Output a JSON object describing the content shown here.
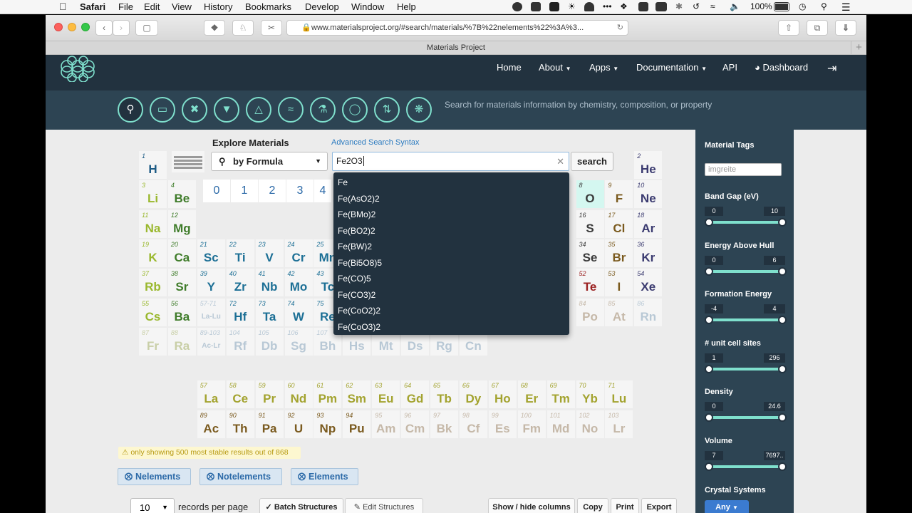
{
  "menubar": {
    "app": "Safari",
    "items": [
      "File",
      "Edit",
      "View",
      "History",
      "Bookmarks",
      "Develop",
      "Window",
      "Help"
    ],
    "battery": "100%",
    "battery_pct": 100
  },
  "browser": {
    "url": "www.materialsproject.org/#search/materials/%7B%22nelements%22%3A%3...",
    "tab_title": "Materials Project",
    "new_tab_symbol": "+"
  },
  "nav": {
    "home": "Home",
    "about": "About",
    "apps": "Apps",
    "documentation": "Documentation",
    "api": "API",
    "dashboard": "Dashboard"
  },
  "tagline": "Search for materials information by chemistry, composition, or property",
  "tools": [
    "search-icon",
    "battery-icon",
    "tools-icon",
    "shield-icon",
    "triangle-icon",
    "feather-icon",
    "flask-icon",
    "thermometer-icon",
    "exchange-icon",
    "aperture-icon"
  ],
  "search": {
    "heading": "Explore Materials",
    "advanced_link": "Advanced Search Syntax",
    "mode": "by Formula",
    "query": "Fe2O3",
    "button": "search",
    "suggestions": [
      "Fe",
      "Fe(AsO2)2",
      "Fe(BMo)2",
      "Fe(BO2)2",
      "Fe(BW)2",
      "Fe(Bi5O8)5",
      "Fe(CO)5",
      "Fe(CO3)2",
      "Fe(CoO2)2",
      "Fe(CoO3)2"
    ],
    "number_buttons": [
      "0",
      "1",
      "2",
      "3",
      "4"
    ]
  },
  "periodic_table": [
    {
      "n": "1",
      "s": "H",
      "row": 0,
      "col": 0,
      "cls": "c-h"
    },
    {
      "n": "2",
      "s": "He",
      "row": 0,
      "col": 17,
      "cls": "c-m"
    },
    {
      "n": "3",
      "s": "Li",
      "row": 1,
      "col": 0,
      "cls": "c-l"
    },
    {
      "n": "4",
      "s": "Be",
      "row": 1,
      "col": 1,
      "cls": "c-b"
    },
    {
      "n": "8",
      "s": "O",
      "row": 1,
      "col": 15,
      "cls": "c-n",
      "sel": true
    },
    {
      "n": "9",
      "s": "F",
      "row": 1,
      "col": 16,
      "cls": "c-act"
    },
    {
      "n": "10",
      "s": "Ne",
      "row": 1,
      "col": 17,
      "cls": "c-m"
    },
    {
      "n": "11",
      "s": "Na",
      "row": 2,
      "col": 0,
      "cls": "c-l"
    },
    {
      "n": "12",
      "s": "Mg",
      "row": 2,
      "col": 1,
      "cls": "c-b"
    },
    {
      "n": "16",
      "s": "S",
      "row": 2,
      "col": 15,
      "cls": "c-n"
    },
    {
      "n": "17",
      "s": "Cl",
      "row": 2,
      "col": 16,
      "cls": "c-act"
    },
    {
      "n": "18",
      "s": "Ar",
      "row": 2,
      "col": 17,
      "cls": "c-m"
    },
    {
      "n": "19",
      "s": "K",
      "row": 3,
      "col": 0,
      "cls": "c-l"
    },
    {
      "n": "20",
      "s": "Ca",
      "row": 3,
      "col": 1,
      "cls": "c-b"
    },
    {
      "n": "21",
      "s": "Sc",
      "row": 3,
      "col": 2,
      "cls": "c-g"
    },
    {
      "n": "22",
      "s": "Ti",
      "row": 3,
      "col": 3,
      "cls": "c-g"
    },
    {
      "n": "23",
      "s": "V",
      "row": 3,
      "col": 4,
      "cls": "c-g"
    },
    {
      "n": "24",
      "s": "Cr",
      "row": 3,
      "col": 5,
      "cls": "c-g"
    },
    {
      "n": "25",
      "s": "Mn",
      "row": 3,
      "col": 6,
      "cls": "c-g"
    },
    {
      "n": "34",
      "s": "Se",
      "row": 3,
      "col": 15,
      "cls": "c-n"
    },
    {
      "n": "35",
      "s": "Br",
      "row": 3,
      "col": 16,
      "cls": "c-act"
    },
    {
      "n": "36",
      "s": "Kr",
      "row": 3,
      "col": 17,
      "cls": "c-m"
    },
    {
      "n": "37",
      "s": "Rb",
      "row": 4,
      "col": 0,
      "cls": "c-l"
    },
    {
      "n": "38",
      "s": "Sr",
      "row": 4,
      "col": 1,
      "cls": "c-b"
    },
    {
      "n": "39",
      "s": "Y",
      "row": 4,
      "col": 2,
      "cls": "c-g"
    },
    {
      "n": "40",
      "s": "Zr",
      "row": 4,
      "col": 3,
      "cls": "c-g"
    },
    {
      "n": "41",
      "s": "Nb",
      "row": 4,
      "col": 4,
      "cls": "c-g"
    },
    {
      "n": "42",
      "s": "Mo",
      "row": 4,
      "col": 5,
      "cls": "c-g"
    },
    {
      "n": "43",
      "s": "Tc",
      "row": 4,
      "col": 6,
      "cls": "c-g"
    },
    {
      "n": "52",
      "s": "Te",
      "row": 4,
      "col": 15,
      "cls": "c-r"
    },
    {
      "n": "53",
      "s": "I",
      "row": 4,
      "col": 16,
      "cls": "c-act"
    },
    {
      "n": "54",
      "s": "Xe",
      "row": 4,
      "col": 17,
      "cls": "c-m"
    },
    {
      "n": "55",
      "s": "Cs",
      "row": 5,
      "col": 0,
      "cls": "c-l"
    },
    {
      "n": "56",
      "s": "Ba",
      "row": 5,
      "col": 1,
      "cls": "c-b"
    },
    {
      "n": "57-71",
      "s": "La-Lu",
      "row": 5,
      "col": 2,
      "cls": "c-dim",
      "small": true
    },
    {
      "n": "72",
      "s": "Hf",
      "row": 5,
      "col": 3,
      "cls": "c-g"
    },
    {
      "n": "73",
      "s": "Ta",
      "row": 5,
      "col": 4,
      "cls": "c-g"
    },
    {
      "n": "74",
      "s": "W",
      "row": 5,
      "col": 5,
      "cls": "c-g"
    },
    {
      "n": "75",
      "s": "Re",
      "row": 5,
      "col": 6,
      "cls": "c-g"
    },
    {
      "n": "84",
      "s": "Po",
      "row": 5,
      "col": 15,
      "cls": "c-dim3"
    },
    {
      "n": "85",
      "s": "At",
      "row": 5,
      "col": 16,
      "cls": "c-dim3"
    },
    {
      "n": "86",
      "s": "Rn",
      "row": 5,
      "col": 17,
      "cls": "c-dim"
    },
    {
      "n": "87",
      "s": "Fr",
      "row": 6,
      "col": 0,
      "cls": "c-dim2"
    },
    {
      "n": "88",
      "s": "Ra",
      "row": 6,
      "col": 1,
      "cls": "c-dim2"
    },
    {
      "n": "89-103",
      "s": "Ac-Lr",
      "row": 6,
      "col": 2,
      "cls": "c-dim",
      "small": true
    },
    {
      "n": "104",
      "s": "Rf",
      "row": 6,
      "col": 3,
      "cls": "c-dim"
    },
    {
      "n": "105",
      "s": "Db",
      "row": 6,
      "col": 4,
      "cls": "c-dim"
    },
    {
      "n": "106",
      "s": "Sg",
      "row": 6,
      "col": 5,
      "cls": "c-dim"
    },
    {
      "n": "107",
      "s": "Bh",
      "row": 6,
      "col": 6,
      "cls": "c-dim"
    },
    {
      "n": "108",
      "s": "Hs",
      "row": 6,
      "col": 7,
      "cls": "c-dim"
    },
    {
      "n": "109",
      "s": "Mt",
      "row": 6,
      "col": 8,
      "cls": "c-dim"
    },
    {
      "n": "110",
      "s": "Ds",
      "row": 6,
      "col": 9,
      "cls": "c-dim"
    },
    {
      "n": "111",
      "s": "Rg",
      "row": 6,
      "col": 10,
      "cls": "c-dim"
    },
    {
      "n": "112",
      "s": "Cn",
      "row": 6,
      "col": 11,
      "cls": "c-dim"
    },
    {
      "n": "57",
      "s": "La",
      "row": 8,
      "col": 2,
      "cls": "c-lan"
    },
    {
      "n": "58",
      "s": "Ce",
      "row": 8,
      "col": 3,
      "cls": "c-lan"
    },
    {
      "n": "59",
      "s": "Pr",
      "row": 8,
      "col": 4,
      "cls": "c-lan"
    },
    {
      "n": "60",
      "s": "Nd",
      "row": 8,
      "col": 5,
      "cls": "c-lan"
    },
    {
      "n": "61",
      "s": "Pm",
      "row": 8,
      "col": 6,
      "cls": "c-lan"
    },
    {
      "n": "62",
      "s": "Sm",
      "row": 8,
      "col": 7,
      "cls": "c-lan"
    },
    {
      "n": "63",
      "s": "Eu",
      "row": 8,
      "col": 8,
      "cls": "c-lan"
    },
    {
      "n": "64",
      "s": "Gd",
      "row": 8,
      "col": 9,
      "cls": "c-lan"
    },
    {
      "n": "65",
      "s": "Tb",
      "row": 8,
      "col": 10,
      "cls": "c-lan"
    },
    {
      "n": "66",
      "s": "Dy",
      "row": 8,
      "col": 11,
      "cls": "c-lan"
    },
    {
      "n": "67",
      "s": "Ho",
      "row": 8,
      "col": 12,
      "cls": "c-lan"
    },
    {
      "n": "68",
      "s": "Er",
      "row": 8,
      "col": 13,
      "cls": "c-lan"
    },
    {
      "n": "69",
      "s": "Tm",
      "row": 8,
      "col": 14,
      "cls": "c-lan"
    },
    {
      "n": "70",
      "s": "Yb",
      "row": 8,
      "col": 15,
      "cls": "c-lan"
    },
    {
      "n": "71",
      "s": "Lu",
      "row": 8,
      "col": 16,
      "cls": "c-lan"
    },
    {
      "n": "89",
      "s": "Ac",
      "row": 9,
      "col": 2,
      "cls": "c-act"
    },
    {
      "n": "90",
      "s": "Th",
      "row": 9,
      "col": 3,
      "cls": "c-act"
    },
    {
      "n": "91",
      "s": "Pa",
      "row": 9,
      "col": 4,
      "cls": "c-act"
    },
    {
      "n": "92",
      "s": "U",
      "row": 9,
      "col": 5,
      "cls": "c-act"
    },
    {
      "n": "93",
      "s": "Np",
      "row": 9,
      "col": 6,
      "cls": "c-act"
    },
    {
      "n": "94",
      "s": "Pu",
      "row": 9,
      "col": 7,
      "cls": "c-act"
    },
    {
      "n": "95",
      "s": "Am",
      "row": 9,
      "col": 8,
      "cls": "c-dim3"
    },
    {
      "n": "96",
      "s": "Cm",
      "row": 9,
      "col": 9,
      "cls": "c-dim3"
    },
    {
      "n": "97",
      "s": "Bk",
      "row": 9,
      "col": 10,
      "cls": "c-dim3"
    },
    {
      "n": "98",
      "s": "Cf",
      "row": 9,
      "col": 11,
      "cls": "c-dim3"
    },
    {
      "n": "99",
      "s": "Es",
      "row": 9,
      "col": 12,
      "cls": "c-dim3"
    },
    {
      "n": "100",
      "s": "Fm",
      "row": 9,
      "col": 13,
      "cls": "c-dim3"
    },
    {
      "n": "101",
      "s": "Md",
      "row": 9,
      "col": 14,
      "cls": "c-dim3"
    },
    {
      "n": "102",
      "s": "No",
      "row": 9,
      "col": 15,
      "cls": "c-dim3"
    },
    {
      "n": "103",
      "s": "Lr",
      "row": 9,
      "col": 16,
      "cls": "c-dim3"
    }
  ],
  "results": {
    "warning": "only showing 500 most stable results out of 868",
    "filters": [
      "Nelements",
      "Notelements",
      "Elements"
    ],
    "records_per_page": "10",
    "records_label": "records per page",
    "batch_structures": "Batch Structures",
    "edit_structures": "Edit Structures",
    "show_hide": "Show / hide columns",
    "copy": "Copy",
    "print": "Print",
    "export": "Export"
  },
  "sidebar": {
    "tags_label": "Material Tags",
    "tags_placeholder": "imgreite",
    "ranges": [
      {
        "label": "Band Gap (eV)",
        "min": "0",
        "max": "10"
      },
      {
        "label": "Energy Above Hull",
        "min": "0",
        "max": "6"
      },
      {
        "label": "Formation Energy",
        "min": "-4",
        "max": "4"
      },
      {
        "label": "# unit cell sites",
        "min": "1",
        "max": "296"
      },
      {
        "label": "Density",
        "min": "0",
        "max": "24.6"
      },
      {
        "label": "Volume",
        "min": "7",
        "max": "7697.."
      }
    ],
    "crystal_label": "Crystal Systems",
    "crystal_button": "Any"
  },
  "colors": {
    "nav_bg": "#22323f",
    "toolbar_bg": "#2d4453",
    "accent": "#7fe0cd",
    "link": "#2c7bc0"
  }
}
